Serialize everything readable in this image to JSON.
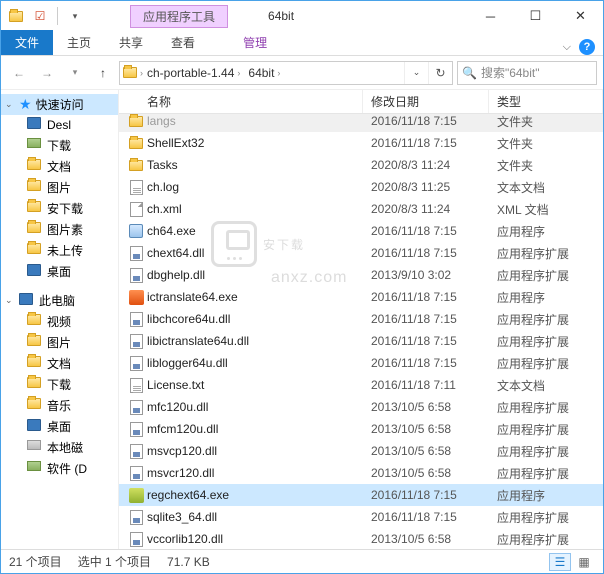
{
  "window": {
    "context_tab": "应用程序工具",
    "title": "64bit"
  },
  "ribbon": {
    "file": "文件",
    "tabs": [
      "主页",
      "共享",
      "查看"
    ],
    "manage": "管理"
  },
  "address": {
    "crumb1": "ch-portable-1.44",
    "crumb2": "64bit"
  },
  "search": {
    "placeholder": "搜索\"64bit\""
  },
  "nav": {
    "quick": "快速访问",
    "items_quick": [
      "Desl",
      "下载",
      "文档",
      "图片",
      "安下载",
      "图片素",
      "未上传",
      "桌面"
    ],
    "pc": "此电脑",
    "items_pc": [
      "视频",
      "图片",
      "文档",
      "下载",
      "音乐",
      "桌面",
      "本地磁",
      "软件 (D"
    ]
  },
  "columns": {
    "name": "名称",
    "date": "修改日期",
    "type": "类型"
  },
  "files": [
    {
      "icon": "folder",
      "name": "langs",
      "date": "2016/11/18 7:15",
      "type": "文件夹",
      "cut": true
    },
    {
      "icon": "folder",
      "name": "ShellExt32",
      "date": "2016/11/18 7:15",
      "type": "文件夹"
    },
    {
      "icon": "folder",
      "name": "Tasks",
      "date": "2020/8/3 11:24",
      "type": "文件夹"
    },
    {
      "icon": "txt",
      "name": "ch.log",
      "date": "2020/8/3 11:25",
      "type": "文本文档"
    },
    {
      "icon": "file",
      "name": "ch.xml",
      "date": "2020/8/3 11:24",
      "type": "XML 文档"
    },
    {
      "icon": "exe",
      "name": "ch64.exe",
      "date": "2016/11/18 7:15",
      "type": "应用程序"
    },
    {
      "icon": "dll",
      "name": "chext64.dll",
      "date": "2016/11/18 7:15",
      "type": "应用程序扩展"
    },
    {
      "icon": "dll",
      "name": "dbghelp.dll",
      "date": "2013/9/10 3:02",
      "type": "应用程序扩展"
    },
    {
      "icon": "ictranslate",
      "name": "ictranslate64.exe",
      "date": "2016/11/18 7:15",
      "type": "应用程序"
    },
    {
      "icon": "dll",
      "name": "libchcore64u.dll",
      "date": "2016/11/18 7:15",
      "type": "应用程序扩展"
    },
    {
      "icon": "dll",
      "name": "libictranslate64u.dll",
      "date": "2016/11/18 7:15",
      "type": "应用程序扩展"
    },
    {
      "icon": "dll",
      "name": "liblogger64u.dll",
      "date": "2016/11/18 7:15",
      "type": "应用程序扩展"
    },
    {
      "icon": "txt",
      "name": "License.txt",
      "date": "2016/11/18 7:11",
      "type": "文本文档"
    },
    {
      "icon": "dll",
      "name": "mfc120u.dll",
      "date": "2013/10/5 6:58",
      "type": "应用程序扩展"
    },
    {
      "icon": "dll",
      "name": "mfcm120u.dll",
      "date": "2013/10/5 6:58",
      "type": "应用程序扩展"
    },
    {
      "icon": "dll",
      "name": "msvcp120.dll",
      "date": "2013/10/5 6:58",
      "type": "应用程序扩展"
    },
    {
      "icon": "dll",
      "name": "msvcr120.dll",
      "date": "2013/10/5 6:58",
      "type": "应用程序扩展"
    },
    {
      "icon": "regch",
      "name": "regchext64.exe",
      "date": "2016/11/18 7:15",
      "type": "应用程序",
      "selected": true
    },
    {
      "icon": "dll",
      "name": "sqlite3_64.dll",
      "date": "2016/11/18 7:15",
      "type": "应用程序扩展"
    },
    {
      "icon": "dll",
      "name": "vccorlib120.dll",
      "date": "2013/10/5 6:58",
      "type": "应用程序扩展"
    }
  ],
  "status": {
    "count": "21 个项目",
    "selection": "选中 1 个项目",
    "size": "71.7 KB"
  },
  "watermark": {
    "main": "安下载",
    "sub": "anxz.com"
  }
}
